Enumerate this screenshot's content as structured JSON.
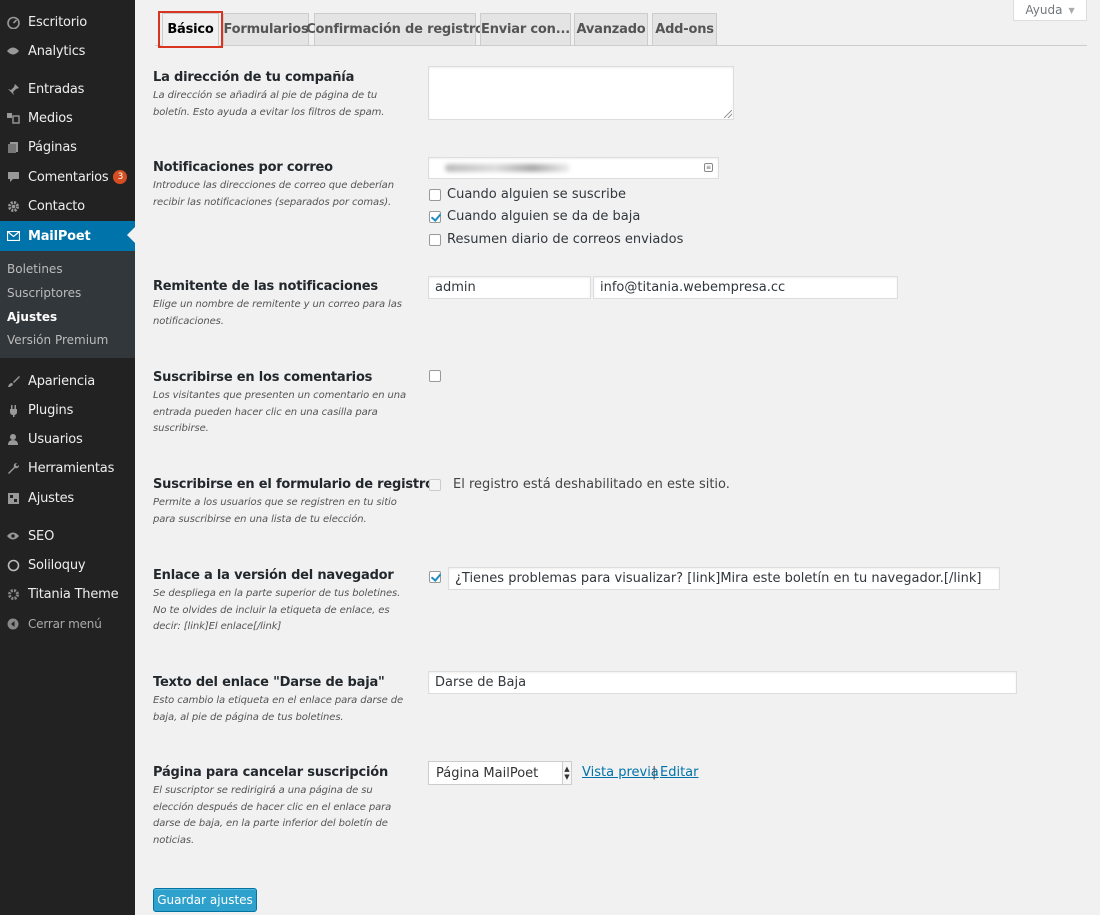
{
  "sidebar": {
    "items": [
      {
        "label": "Escritorio",
        "icon": "dashboard-icon"
      },
      {
        "label": "Analytics",
        "icon": "analytics-icon"
      },
      {
        "label": "Entradas",
        "icon": "pin-icon"
      },
      {
        "label": "Medios",
        "icon": "media-icon"
      },
      {
        "label": "Páginas",
        "icon": "pages-icon"
      },
      {
        "label": "Comentarios",
        "icon": "comments-icon",
        "badge": "3"
      },
      {
        "label": "Contacto",
        "icon": "gear-icon"
      },
      {
        "label": "MailPoet",
        "icon": "mail-icon"
      },
      {
        "label": "Apariencia",
        "icon": "brush-icon"
      },
      {
        "label": "Plugins",
        "icon": "plugin-icon"
      },
      {
        "label": "Usuarios",
        "icon": "user-icon"
      },
      {
        "label": "Herramientas",
        "icon": "wrench-icon"
      },
      {
        "label": "Ajustes",
        "icon": "settings-icon"
      },
      {
        "label": "SEO",
        "icon": "seo-icon"
      },
      {
        "label": "Soliloquy",
        "icon": "slider-icon"
      },
      {
        "label": "Titania Theme",
        "icon": "theme-gear-icon"
      }
    ],
    "submenu": [
      "Boletines",
      "Suscriptores",
      "Ajustes",
      "Versión Premium"
    ],
    "collapse_label": "Cerrar menú"
  },
  "help_label": "Ayuda",
  "tabs": [
    "Básico",
    "Formularios",
    "Confirmación de registro",
    "Enviar con...",
    "Avanzado",
    "Add-ons"
  ],
  "rows": {
    "company": {
      "label": "La dirección de tu compañía",
      "desc": "La dirección se añadirá al pie de página de tu boletín. Esto ayuda a evitar los filtros de spam."
    },
    "notifications": {
      "label": "Notificaciones por correo",
      "desc": "Introduce las direcciones de correo que deberían recibir las notificaciones (separados por comas).",
      "options": [
        {
          "label": "Cuando alguien se suscribe",
          "checked": false
        },
        {
          "label": "Cuando alguien se da de baja",
          "checked": true
        },
        {
          "label": "Resumen diario de correos enviados",
          "checked": false
        }
      ]
    },
    "sender": {
      "label": "Remitente de las notificaciones",
      "desc": "Elige un nombre de remitente y un correo para las notificaciones.",
      "name_value": "admin",
      "email_value": "info@titania.webempresa.cc"
    },
    "comments": {
      "label": "Suscribirse en los comentarios",
      "desc": "Los visitantes que presenten un comentario en una entrada pueden hacer clic en una casilla para suscribirse.",
      "checked": false
    },
    "registration": {
      "label": "Suscribirse en el formulario de registro",
      "desc": "Permite a los usuarios que se registren en tu sitio para suscribirse en una lista de tu elección.",
      "note": "El registro está deshabilitado en este sitio."
    },
    "browser": {
      "label": "Enlace a la versión del navegador",
      "desc": "Se despliega en la parte superior de tus boletines. No te olvides de incluir la etiqueta de enlace, es decir: [link]El enlace[/link]",
      "checked": true,
      "value": "¿Tienes problemas para visualizar? [link]Mira este boletín en tu navegador.[/link]"
    },
    "unsubscribe_text": {
      "label": "Texto del enlace \"Darse de baja\"",
      "desc": "Esto cambio la etiqueta en el enlace para darse de baja, al pie de página de tus boletines.",
      "value": "Darse de Baja"
    },
    "unsubscribe_page": {
      "label": "Página para cancelar suscripción",
      "desc": "El suscriptor se redirigirá a una página de su elección después de hacer clic en el enlace para darse de baja, en la parte inferior del boletín de noticias.",
      "selected": "Página MailPoet",
      "preview_link": "Vista previa",
      "separator": "|",
      "edit_link": "Editar"
    }
  },
  "save_label": "Guardar ajustes",
  "colors": {
    "sidebar_bg": "#222222",
    "active_blue": "#0073aa",
    "primary_button": "#2ea2cc",
    "badge": "#d54e21",
    "highlight_box": "#d9341f"
  }
}
